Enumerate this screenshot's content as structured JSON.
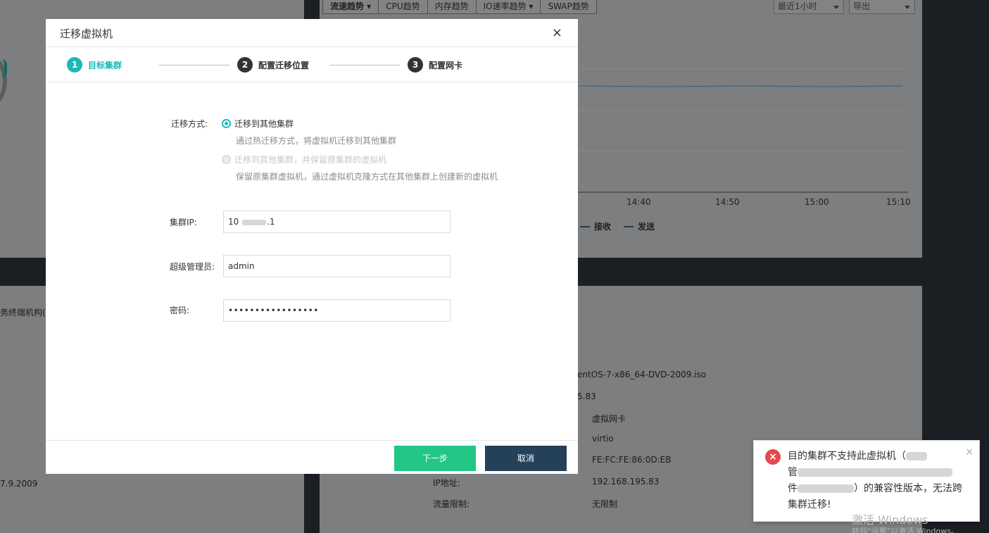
{
  "background": {
    "tabs": [
      {
        "label": "流速趋势 ▾",
        "active": true
      },
      {
        "label": "CPU趋势",
        "active": false
      },
      {
        "label": "内存趋势",
        "active": false
      },
      {
        "label": "IO速率趋势 ▾",
        "active": false
      },
      {
        "label": "SWAP趋势",
        "active": false
      }
    ],
    "time_range": "最近1小时",
    "export": "导出",
    "x_ticks": [
      "14:40",
      "14:50",
      "15:00",
      "15:10"
    ],
    "legend": [
      "接收",
      "发送"
    ],
    "left_snippet": "务终端机构(",
    "left_version": "7.9.2009",
    "iso": "entOS-7-x86_64-DVD-2009.iso",
    "ip_partial": "5.83",
    "nic_type": "虚拟网卡",
    "nic_model": "virtio",
    "mac": "FE:FC:FE:86:0D:EB",
    "ip_label": "IP地址:",
    "ip_value": "192.168.195.83",
    "traffic_label": "流量限制:",
    "traffic_value": "无限制"
  },
  "modal": {
    "title": "迁移虚拟机",
    "close": "×",
    "steps": [
      {
        "num": "1",
        "label": "目标集群"
      },
      {
        "num": "2",
        "label": "配置迁移位置"
      },
      {
        "num": "3",
        "label": "配置网卡"
      }
    ],
    "migrate_mode_label": "迁移方式:",
    "option1_label": "迁移到其他集群",
    "option1_hint": "通过热迁移方式，将虚拟机迁移到其他集群",
    "option2_label": "迁移到其他集群，并保留原集群的虚拟机",
    "option2_hint": "保留原集群虚拟机，通过虚拟机克隆方式在其他集群上创建新的虚拟机",
    "cluster_ip_label": "集群IP:",
    "cluster_ip_prefix": "10",
    "cluster_ip_suffix": ".1",
    "admin_label": "超级管理员:",
    "admin_value": "admin",
    "password_label": "密码:",
    "password_value": "•••••••••••••••••",
    "next_button": "下一步",
    "cancel_button": "取消"
  },
  "toast": {
    "icon": "×",
    "line1": "目的集群不支持此虚拟机（",
    "line2a": "管",
    "line2b": "件",
    "line2c": "）的兼容性版本，无法跨",
    "line3": "集群迁移!",
    "close": "×"
  },
  "watermark": {
    "line1": "激活 Windows",
    "line2": "转到“设置”以激活 Windows。"
  },
  "colors": {
    "accent": "#1db8b8",
    "next": "#22c785",
    "cancel": "#25415a",
    "error": "#e5484d"
  }
}
